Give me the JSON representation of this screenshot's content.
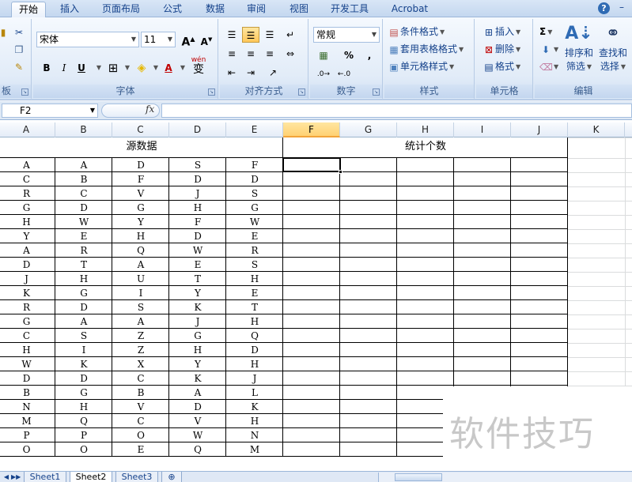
{
  "tabs": [
    {
      "label": "开始",
      "active": true
    },
    {
      "label": "插入"
    },
    {
      "label": "页面布局"
    },
    {
      "label": "公式"
    },
    {
      "label": "数据"
    },
    {
      "label": "审阅"
    },
    {
      "label": "视图"
    },
    {
      "label": "开发工具"
    },
    {
      "label": "Acrobat"
    }
  ],
  "ribbon": {
    "clipboard": {
      "label": "板"
    },
    "font": {
      "label": "字体",
      "name": "宋体",
      "size": "11",
      "grow": "A",
      "shrink": "A",
      "bold": "B",
      "italic": "I",
      "underline": "U",
      "phonetic": "wén",
      "phonetic_char": "变"
    },
    "alignment": {
      "label": "对齐方式"
    },
    "number": {
      "label": "数字",
      "format": "常规",
      "percent": "%",
      "comma": ","
    },
    "styles": {
      "label": "样式",
      "conditional": "条件格式",
      "table_format": "套用表格格式",
      "cell_styles": "单元格样式"
    },
    "cells": {
      "label": "单元格",
      "insert": "插入",
      "delete": "删除",
      "format": "格式"
    },
    "editing": {
      "label": "编辑",
      "sum": "Σ",
      "sort_filter": [
        "排序和",
        "筛选"
      ],
      "find_select": [
        "查找和",
        "选择"
      ]
    }
  },
  "formula_bar": {
    "name_box": "F2",
    "fx": "fx",
    "content": ""
  },
  "columns": [
    "A",
    "B",
    "C",
    "D",
    "E",
    "F",
    "G",
    "H",
    "I",
    "J",
    "K"
  ],
  "selected_column": "F",
  "sheet": {
    "source_header": "源数据",
    "count_header": "统计个数",
    "rows": [
      [
        "A",
        "A",
        "D",
        "S",
        "F"
      ],
      [
        "C",
        "B",
        "F",
        "D",
        "D"
      ],
      [
        "R",
        "C",
        "V",
        "J",
        "S"
      ],
      [
        "G",
        "D",
        "G",
        "H",
        "G"
      ],
      [
        "H",
        "W",
        "Y",
        "F",
        "W"
      ],
      [
        "Y",
        "E",
        "H",
        "D",
        "E"
      ],
      [
        "A",
        "R",
        "Q",
        "W",
        "R"
      ],
      [
        "D",
        "T",
        "A",
        "E",
        "S"
      ],
      [
        "J",
        "H",
        "U",
        "T",
        "H"
      ],
      [
        "K",
        "G",
        "I",
        "Y",
        "E"
      ],
      [
        "R",
        "D",
        "S",
        "K",
        "T"
      ],
      [
        "G",
        "A",
        "A",
        "J",
        "H"
      ],
      [
        "C",
        "S",
        "Z",
        "G",
        "Q"
      ],
      [
        "H",
        "I",
        "Z",
        "H",
        "D"
      ],
      [
        "W",
        "K",
        "X",
        "Y",
        "H"
      ],
      [
        "D",
        "D",
        "C",
        "K",
        "J"
      ],
      [
        "B",
        "G",
        "B",
        "A",
        "L"
      ],
      [
        "N",
        "H",
        "V",
        "D",
        "K"
      ],
      [
        "M",
        "Q",
        "C",
        "V",
        "H"
      ],
      [
        "P",
        "P",
        "O",
        "W",
        "N"
      ],
      [
        "O",
        "O",
        "E",
        "Q",
        "M"
      ]
    ]
  },
  "sheet_tabs": [
    {
      "label": "Sheet1"
    },
    {
      "label": "Sheet2",
      "active": true
    },
    {
      "label": "Sheet3"
    }
  ],
  "watermark": "软件技巧",
  "colors": {
    "ribbon_text": "#15428b",
    "selected_header": "#ffd173",
    "accent_blue": "#2f6bb4"
  }
}
